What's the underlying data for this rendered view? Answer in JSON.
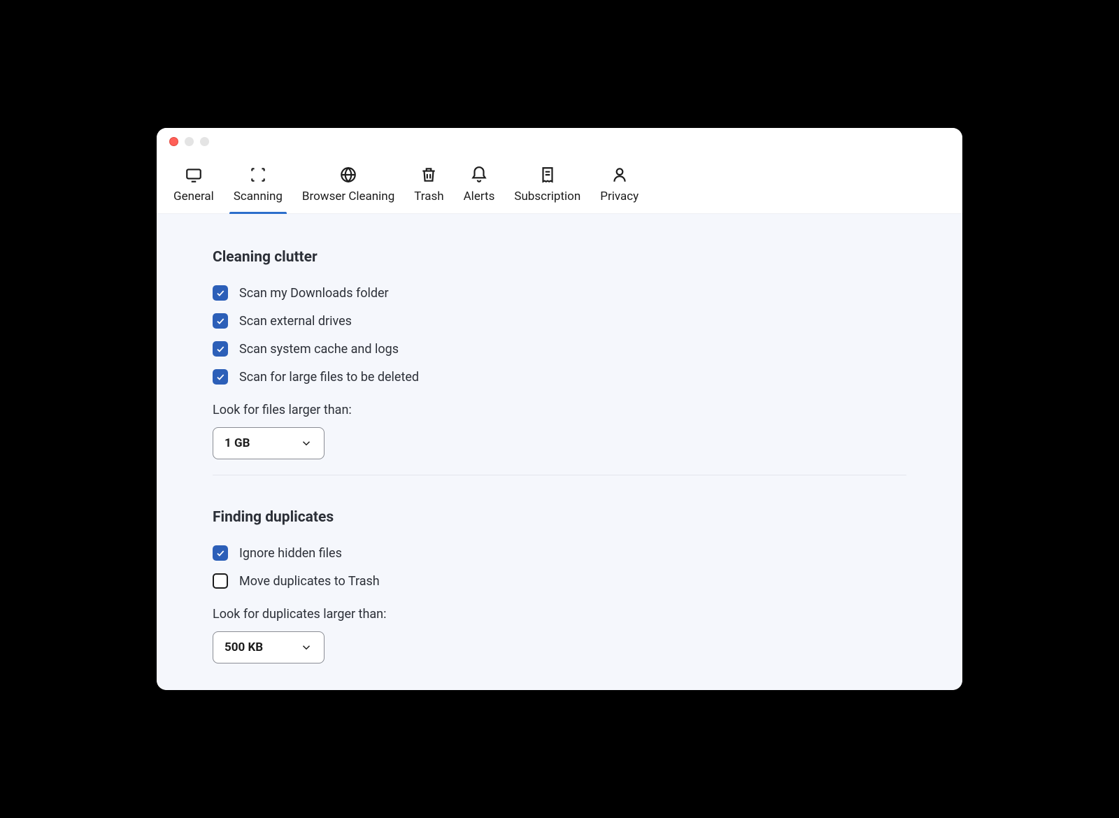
{
  "tabs": [
    {
      "label": "General"
    },
    {
      "label": "Scanning"
    },
    {
      "label": "Browser Cleaning"
    },
    {
      "label": "Trash"
    },
    {
      "label": "Alerts"
    },
    {
      "label": "Subscription"
    },
    {
      "label": "Privacy"
    }
  ],
  "active_tab_index": 1,
  "sections": {
    "clutter": {
      "title": "Cleaning clutter",
      "options": [
        {
          "label": "Scan my Downloads folder",
          "checked": true
        },
        {
          "label": "Scan external drives",
          "checked": true
        },
        {
          "label": "Scan system cache and logs",
          "checked": true
        },
        {
          "label": "Scan for large files to be deleted",
          "checked": true
        }
      ],
      "size_label": "Look for files larger than:",
      "size_value": "1 GB"
    },
    "duplicates": {
      "title": "Finding duplicates",
      "options": [
        {
          "label": "Ignore hidden files",
          "checked": true
        },
        {
          "label": "Move duplicates to Trash",
          "checked": false
        }
      ],
      "size_label": "Look for duplicates larger than:",
      "size_value": "500 KB"
    }
  }
}
